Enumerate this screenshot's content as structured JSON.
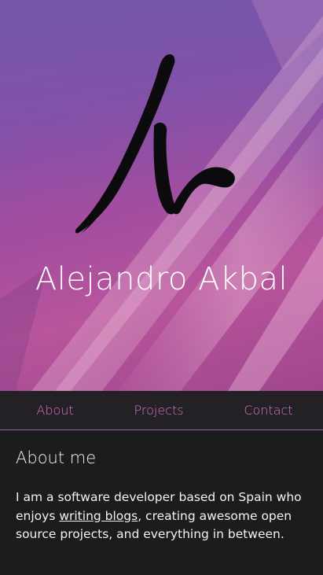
{
  "hero": {
    "title": "Alejandro Akbal",
    "logo_icon": "signature-logo-icon"
  },
  "nav": {
    "items": [
      {
        "label": "About"
      },
      {
        "label": "Projects"
      },
      {
        "label": "Contact"
      }
    ]
  },
  "about": {
    "heading": "About me",
    "text_before": "I am a software developer based on Spain who enjoys ",
    "link_label": "writing blogs",
    "text_after": ", creating awesome open source projects, and everything in between."
  },
  "colors": {
    "nav_accent": "#d876c2",
    "background": "#1b1c1e",
    "hero_purple": "#8a4ea6",
    "hero_pink": "#b8559c"
  }
}
